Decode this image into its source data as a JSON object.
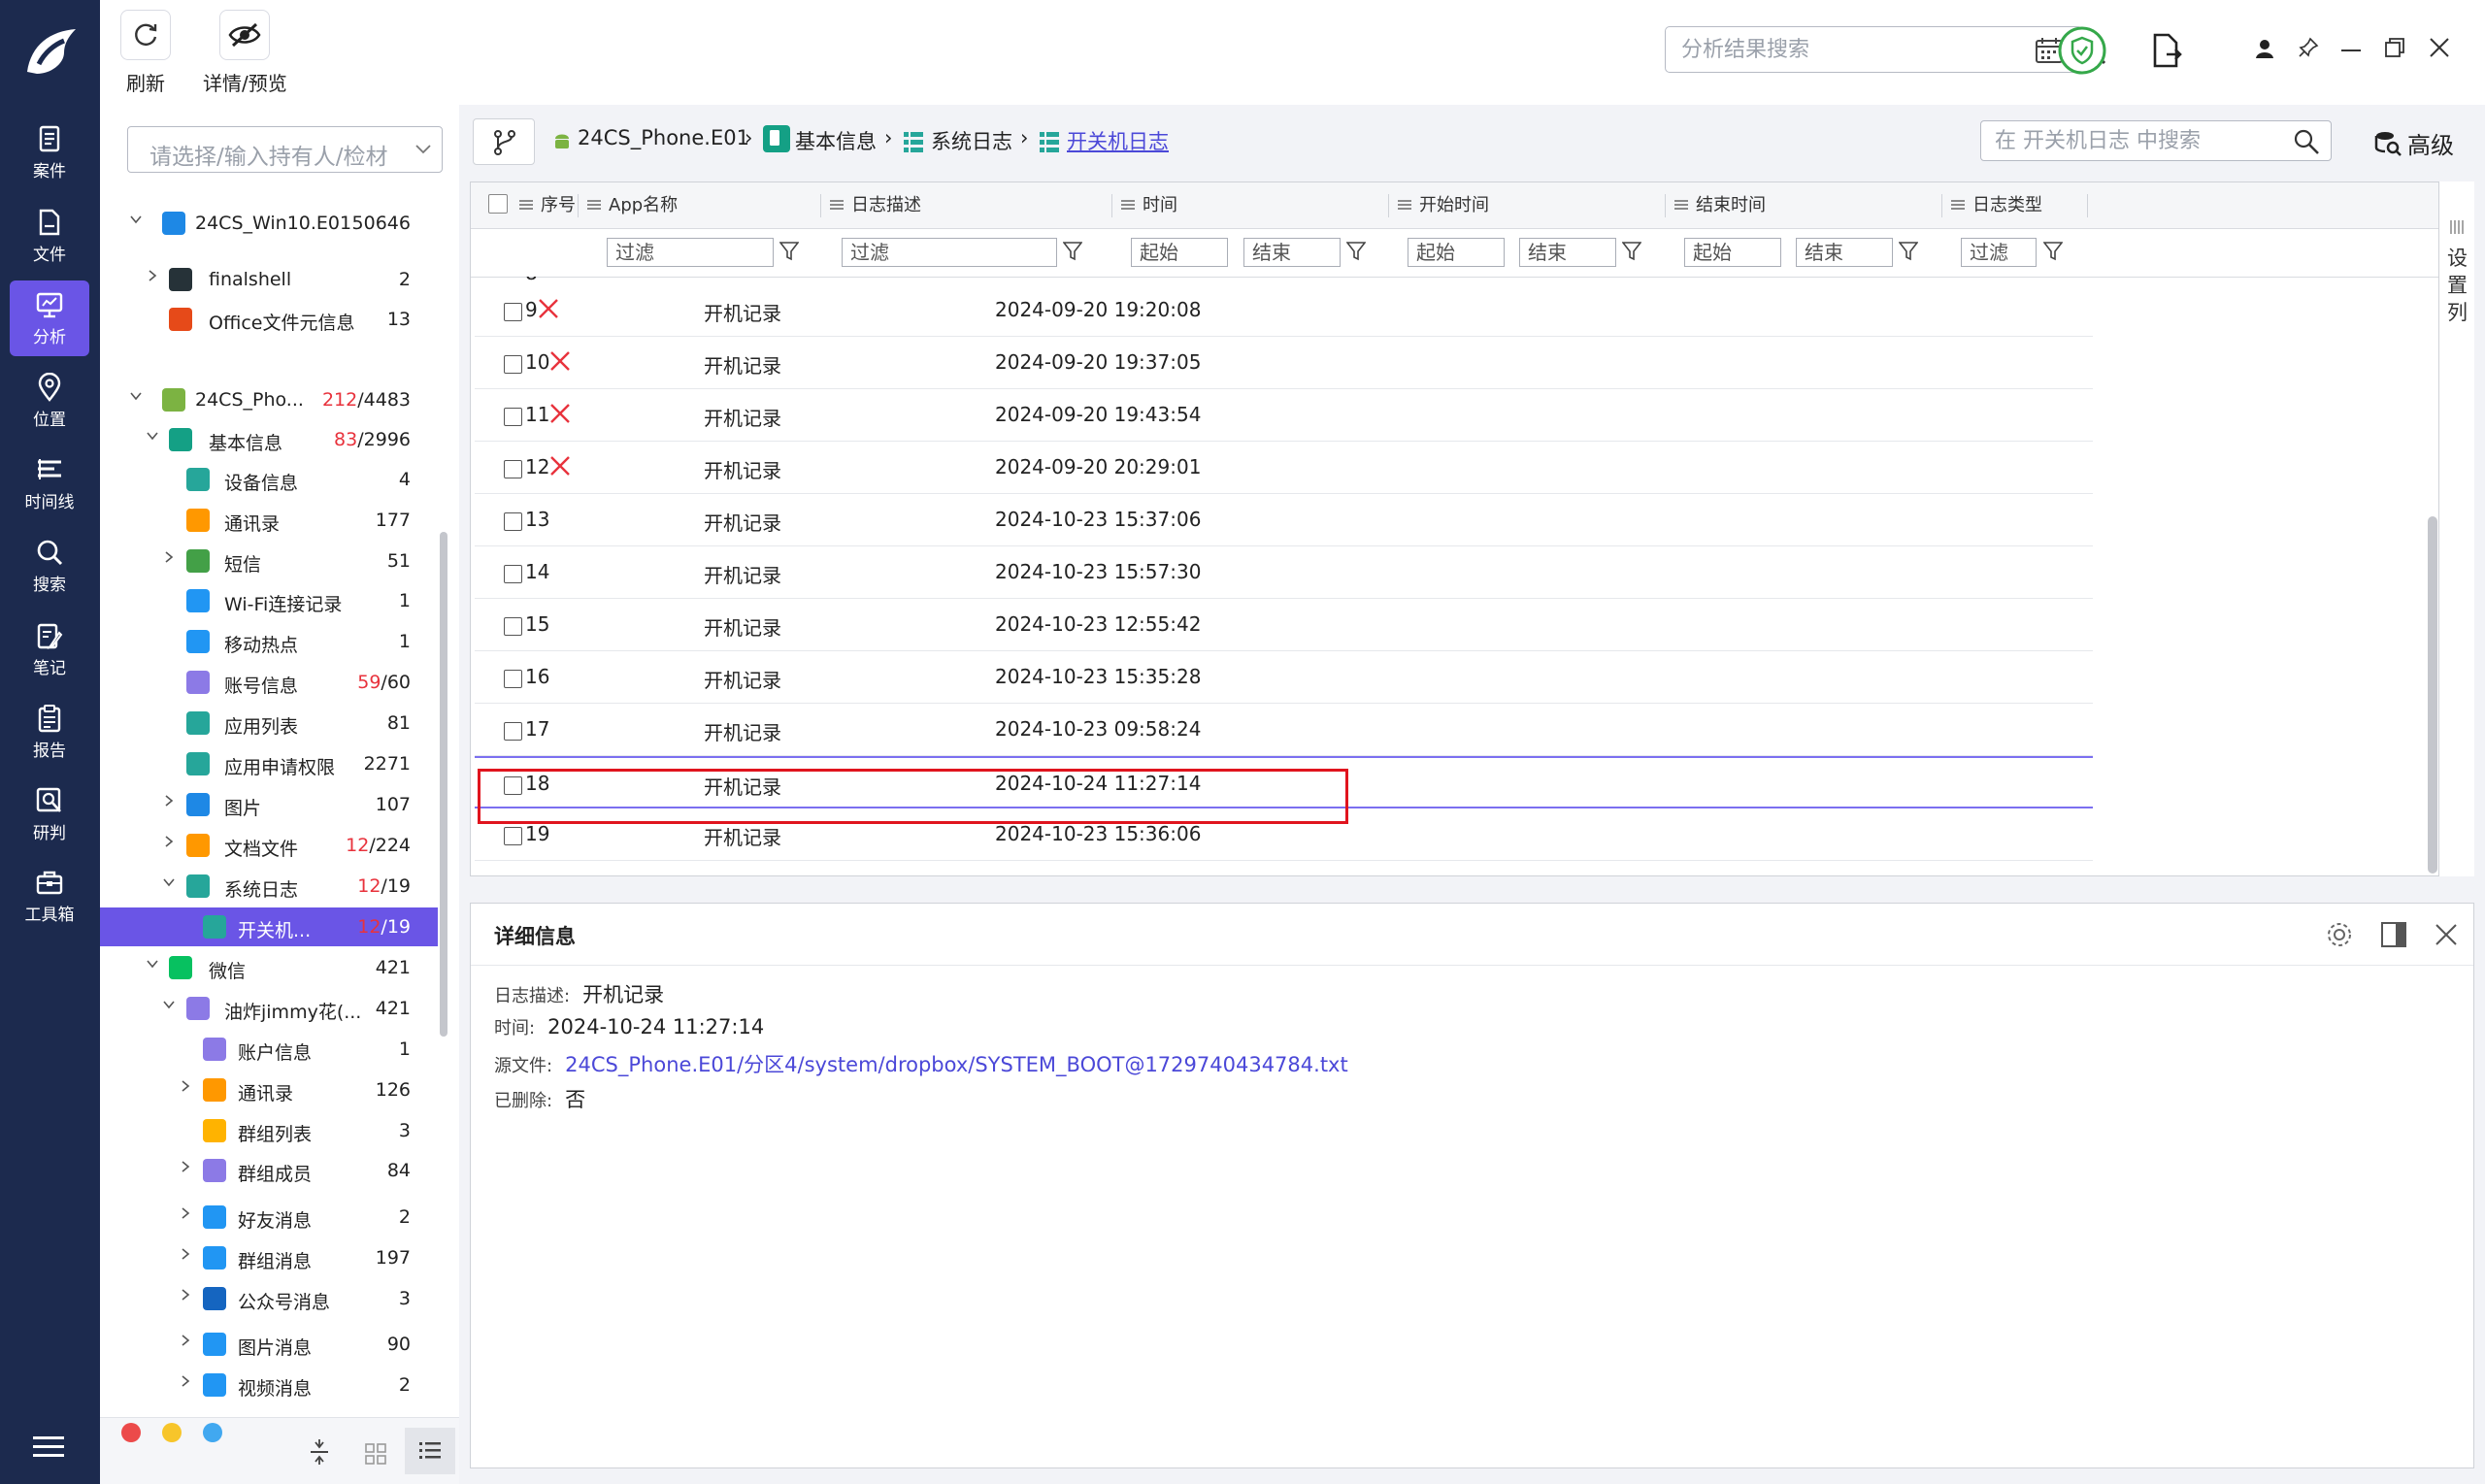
{
  "toolbar": {
    "refresh_label": "刷新",
    "preview_label": "详情/预览",
    "search_placeholder": "分析结果搜索"
  },
  "nav": [
    {
      "label": "案件",
      "icon": "case-icon"
    },
    {
      "label": "文件",
      "icon": "file-icon"
    },
    {
      "label": "分析",
      "icon": "analysis-icon",
      "active": true
    },
    {
      "label": "位置",
      "icon": "location-icon"
    },
    {
      "label": "时间线",
      "icon": "timeline-icon"
    },
    {
      "label": "搜索",
      "icon": "search-icon"
    },
    {
      "label": "笔记",
      "icon": "note-icon"
    },
    {
      "label": "报告",
      "icon": "report-icon"
    },
    {
      "label": "研判",
      "icon": "judgment-icon"
    },
    {
      "label": "工具箱",
      "icon": "toolbox-icon"
    }
  ],
  "tree": {
    "select_placeholder": "请选择/输入持有人/检材",
    "rows": [
      {
        "level": 0,
        "arrow": "down",
        "icon": "windows-icon",
        "color": "#1e88e5",
        "label": "24CS_Win10.E01",
        "count": "50646"
      },
      {
        "level": 1,
        "arrow": "right",
        "icon": "finalshell-icon",
        "color": "#263238",
        "label": "finalshell",
        "count": "2"
      },
      {
        "level": 1,
        "arrow": "",
        "icon": "office-icon",
        "color": "#e64a19",
        "label": "Office文件元信息",
        "count": "13"
      },
      {
        "level": 0,
        "arrow": "down",
        "icon": "android-icon",
        "color": "#7cb342",
        "label": "24CS_Pho...",
        "count_red": "212",
        "count": "/4483"
      },
      {
        "level": 1,
        "arrow": "down",
        "icon": "basic-info-icon",
        "color": "#14a085",
        "label": "基本信息",
        "count_red": "83",
        "count": "/2996"
      },
      {
        "level": 2,
        "arrow": "",
        "icon": "device-info-icon",
        "color": "#26a69a",
        "label": "设备信息",
        "count": "4"
      },
      {
        "level": 2,
        "arrow": "",
        "icon": "contacts-icon",
        "color": "#ff9800",
        "label": "通讯录",
        "count": "177"
      },
      {
        "level": 2,
        "arrow": "right",
        "icon": "sms-icon",
        "color": "#43a047",
        "label": "短信",
        "count": "51"
      },
      {
        "level": 2,
        "arrow": "",
        "icon": "wifi-icon",
        "color": "#2196f3",
        "label": "Wi-Fi连接记录",
        "count": "1"
      },
      {
        "level": 2,
        "arrow": "",
        "icon": "hotspot-icon",
        "color": "#2196f3",
        "label": "移动热点",
        "count": "1"
      },
      {
        "level": 2,
        "arrow": "",
        "icon": "account-icon",
        "color": "#8c7ae6",
        "label": "账号信息",
        "count_red": "59",
        "count": "/60"
      },
      {
        "level": 2,
        "arrow": "",
        "icon": "app-list-icon",
        "color": "#26a69a",
        "label": "应用列表",
        "count": "81"
      },
      {
        "level": 2,
        "arrow": "",
        "icon": "app-permission-icon",
        "color": "#26a69a",
        "label": "应用申请权限",
        "count": "2271"
      },
      {
        "level": 2,
        "arrow": "right",
        "icon": "image-icon",
        "color": "#1e88e5",
        "label": "图片",
        "count": "107"
      },
      {
        "level": 2,
        "arrow": "right",
        "icon": "document-icon",
        "color": "#ff9800",
        "label": "文档文件",
        "count_red": "12",
        "count": "/224"
      },
      {
        "level": 2,
        "arrow": "down",
        "icon": "syslog-icon",
        "color": "#26a69a",
        "label": "系统日志",
        "count_red": "12",
        "count": "/19"
      },
      {
        "level": 3,
        "arrow": "",
        "icon": "power-log-icon",
        "color": "#26a69a",
        "label": "开关机...",
        "count_red": "12",
        "count": "/19",
        "selected": true
      },
      {
        "level": 1,
        "arrow": "down",
        "icon": "wechat-icon",
        "color": "#07c160",
        "label": "微信",
        "count": "421"
      },
      {
        "level": 2,
        "arrow": "down",
        "icon": "wechat-user-icon",
        "color": "#8c7ae6",
        "label": "油炸jimmy花(...",
        "count": "421"
      },
      {
        "level": 3,
        "arrow": "",
        "icon": "account-info-icon",
        "color": "#8c7ae6",
        "label": "账户信息",
        "count": "1"
      },
      {
        "level": 3,
        "arrow": "right",
        "icon": "contacts-icon",
        "color": "#ff9800",
        "label": "通讯录",
        "count": "126"
      },
      {
        "level": 3,
        "arrow": "",
        "icon": "group-list-icon",
        "color": "#ffb300",
        "label": "群组列表",
        "count": "3"
      },
      {
        "level": 3,
        "arrow": "right",
        "icon": "group-member-icon",
        "color": "#8c7ae6",
        "label": "群组成员",
        "count": "84"
      },
      {
        "level": 3,
        "arrow": "right",
        "icon": "chat-icon",
        "color": "#2196f3",
        "label": "好友消息",
        "count": "2"
      },
      {
        "level": 3,
        "arrow": "right",
        "icon": "chat-icon",
        "color": "#2196f3",
        "label": "群组消息",
        "count": "197"
      },
      {
        "level": 3,
        "arrow": "right",
        "icon": "official-account-icon",
        "color": "#1565c0",
        "label": "公众号消息",
        "count": "3"
      },
      {
        "level": 3,
        "arrow": "right",
        "icon": "chat-icon",
        "color": "#2196f3",
        "label": "图片消息",
        "count": "90"
      },
      {
        "level": 3,
        "arrow": "right",
        "icon": "chat-icon",
        "color": "#2196f3",
        "label": "视频消息",
        "count": "2"
      }
    ]
  },
  "breadcrumb": [
    "24CS_Phone.E01",
    "基本信息",
    "系统日志",
    "开关机日志"
  ],
  "grid_search_placeholder": "在 开关机日志 中搜索",
  "advanced_label": "高级",
  "columns": {
    "index": "序号",
    "app": "App名称",
    "desc": "日志描述",
    "time": "时间",
    "start": "开始时间",
    "end": "结束时间",
    "type": "日志类型"
  },
  "filters": {
    "filter": "过滤",
    "start": "起始",
    "end": "结束"
  },
  "rows": [
    {
      "index": "9",
      "deleted": true,
      "desc": "开机记录",
      "time": "2024-09-20 19:20:08"
    },
    {
      "index": "10",
      "deleted": true,
      "desc": "开机记录",
      "time": "2024-09-20 19:37:05"
    },
    {
      "index": "11",
      "deleted": true,
      "desc": "开机记录",
      "time": "2024-09-20 19:43:54"
    },
    {
      "index": "12",
      "deleted": true,
      "desc": "开机记录",
      "time": "2024-09-20 20:29:01"
    },
    {
      "index": "13",
      "deleted": false,
      "desc": "开机记录",
      "time": "2024-10-23 15:37:06"
    },
    {
      "index": "14",
      "deleted": false,
      "desc": "开机记录",
      "time": "2024-10-23 15:57:30"
    },
    {
      "index": "15",
      "deleted": false,
      "desc": "开机记录",
      "time": "2024-10-23 12:55:42"
    },
    {
      "index": "16",
      "deleted": false,
      "desc": "开机记录",
      "time": "2024-10-23 15:35:28"
    },
    {
      "index": "17",
      "deleted": false,
      "desc": "开机记录",
      "time": "2024-10-23 09:58:24"
    },
    {
      "index": "18",
      "deleted": false,
      "desc": "开机记录",
      "time": "2024-10-24 11:27:14",
      "selected": true
    },
    {
      "index": "19",
      "deleted": false,
      "desc": "开机记录",
      "time": "2024-10-23 15:36:06"
    }
  ],
  "settings_column_label": "设置列",
  "detail": {
    "title": "详细信息",
    "desc_label": "日志描述:",
    "desc_value": "开机记录",
    "time_label": "时间:",
    "time_value": "2024-10-24 11:27:14",
    "source_label": "源文件:",
    "source_value": "24CS_Phone.E01/分区4/system/dropbox/SYSTEM_BOOT@1729740434784.txt",
    "deleted_label": "已删除:",
    "deleted_value": "否"
  },
  "colors": {
    "nav_bg": "#1c2a4e",
    "accent": "#6a55e6",
    "delete_mark": "#e8323c",
    "highlight_border": "#e0141e",
    "link": "#4b48d8"
  }
}
